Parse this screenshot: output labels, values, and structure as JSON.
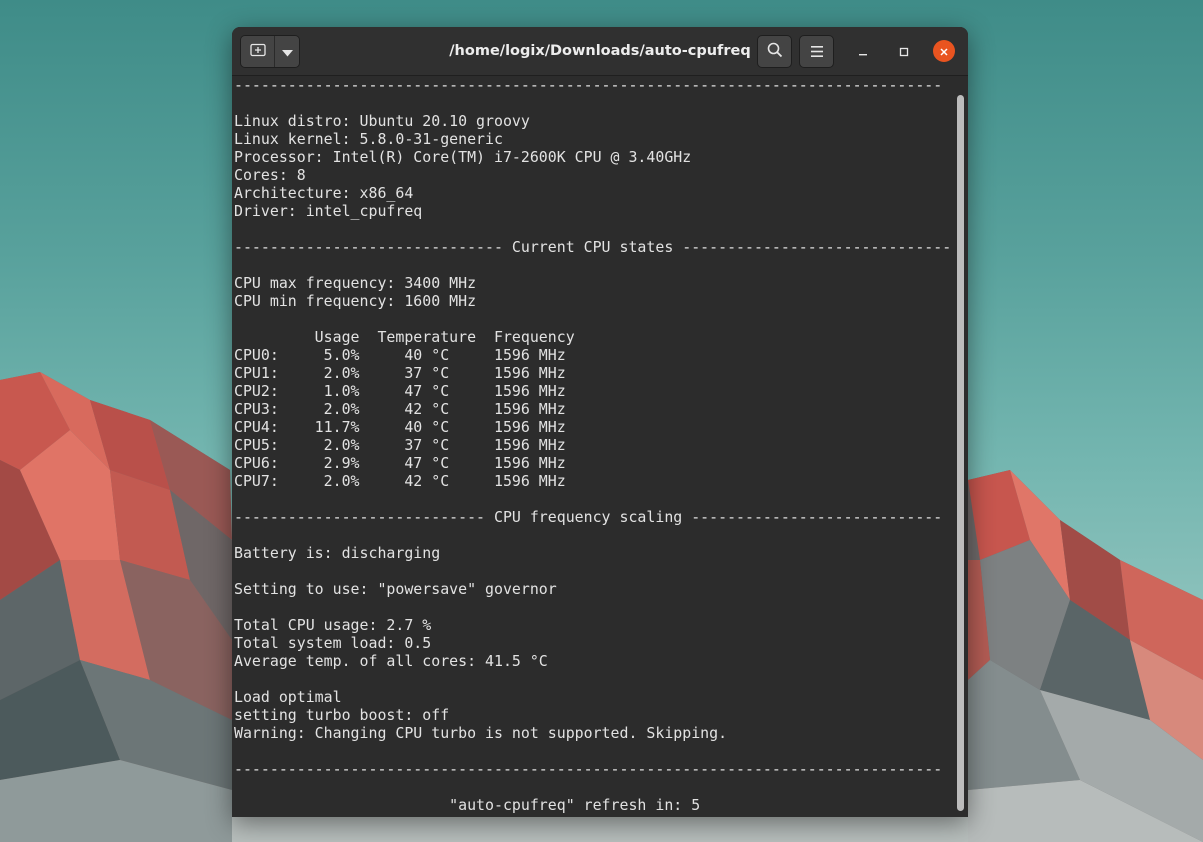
{
  "window": {
    "title": "/home/logix/Downloads/auto-cpufreq"
  },
  "icons": {
    "new_tab": "new-tab-icon",
    "tab_menu": "chevron-down-icon",
    "search": "search-icon",
    "menu": "hamburger-menu-icon",
    "minimize": "minimize-icon",
    "maximize": "maximize-icon",
    "close": "close-icon"
  },
  "colors": {
    "terminal_bg": "#2c2c2c",
    "terminal_fg": "#e2e2e2",
    "close_button": "#e95420",
    "titlebar": "#303030"
  },
  "terminal": {
    "lines": [
      "-------------------------------------------------------------------------------",
      "",
      "Linux distro: Ubuntu 20.10 groovy",
      "Linux kernel: 5.8.0-31-generic",
      "Processor: Intel(R) Core(TM) i7-2600K CPU @ 3.40GHz",
      "Cores: 8",
      "Architecture: x86_64",
      "Driver: intel_cpufreq",
      "",
      "------------------------------ Current CPU states ------------------------------",
      "",
      "CPU max frequency: 3400 MHz",
      "CPU min frequency: 1600 MHz",
      "",
      "         Usage  Temperature  Frequency",
      "CPU0:     5.0%     40 °C     1596 MHz",
      "CPU1:     2.0%     37 °C     1596 MHz",
      "CPU2:     1.0%     47 °C     1596 MHz",
      "CPU3:     2.0%     42 °C     1596 MHz",
      "CPU4:    11.7%     40 °C     1596 MHz",
      "CPU5:     2.0%     37 °C     1596 MHz",
      "CPU6:     2.9%     47 °C     1596 MHz",
      "CPU7:     2.0%     42 °C     1596 MHz",
      "",
      "---------------------------- CPU frequency scaling ----------------------------",
      "",
      "Battery is: discharging",
      "",
      "Setting to use: \"powersave\" governor",
      "",
      "Total CPU usage: 2.7 %",
      "Total system load: 0.5",
      "Average temp. of all cores: 41.5 °C",
      "",
      "Load optimal",
      "setting turbo boost: off",
      "Warning: Changing CPU turbo is not supported. Skipping.",
      "",
      "-------------------------------------------------------------------------------",
      "",
      "                        \"auto-cpufreq\" refresh in: 5"
    ]
  }
}
